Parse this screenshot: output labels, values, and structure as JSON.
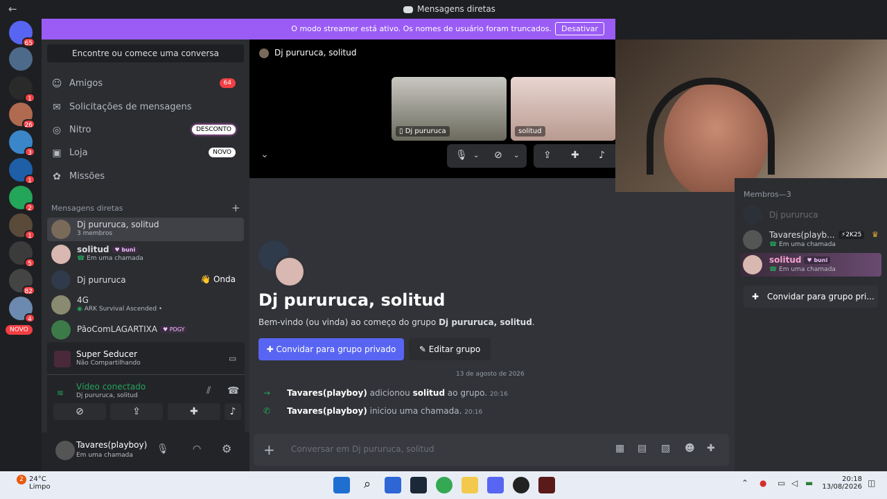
{
  "window": {
    "title": "Mensagens diretas",
    "back_glyph": "←"
  },
  "streamer_banner": {
    "message": "O modo streamer está ativo. Os nomes de usuário foram truncados.",
    "button": "Desativar"
  },
  "rail": {
    "badges": [
      "65",
      "1",
      "26",
      "3",
      "1",
      "2",
      "1",
      "5",
      "82",
      "4"
    ],
    "novo_label": "NOVO"
  },
  "sidebar": {
    "search_label": "Encontre ou comece uma conversa",
    "nav": [
      {
        "label": "Amigos",
        "icon": "friends-icon",
        "pill": "64"
      },
      {
        "label": "Solicitações de mensagens",
        "icon": "mail-icon",
        "pill": ""
      },
      {
        "label": "Nitro",
        "icon": "nitro-icon",
        "pill": "DESCONTO"
      },
      {
        "label": "Loja",
        "icon": "shop-icon",
        "pill": "NOVO"
      },
      {
        "label": "Missões",
        "icon": "quests-icon",
        "pill": ""
      }
    ],
    "dm_header": "Mensagens diretas",
    "dms": [
      {
        "name": "Dj pururuca, solitud",
        "sub": "3 membros"
      },
      {
        "name": "solitud",
        "tag": "buni",
        "sub": "Em uma chamada"
      },
      {
        "name": "Dj pururuca",
        "action": "👋 Onda"
      },
      {
        "name": "4G",
        "sub": "ARK Survival Ascended •"
      },
      {
        "name": "PãoComLAGARTIXA",
        "tag": "PDGY"
      }
    ]
  },
  "voice_panel": {
    "activity_title": "Super Seducer",
    "activity_sub": "Não Compartilhando",
    "status": "Vídeo conectado",
    "channel": "Dj pururuca, solitud"
  },
  "user": {
    "name": "Tavares(playboy)",
    "status": "Em uma chamada"
  },
  "call": {
    "header": "Dj pururuca, solitud",
    "tiles": [
      {
        "label": "Dj pururuca"
      },
      {
        "label": "solitud"
      }
    ]
  },
  "members": {
    "header": "Membros—3",
    "list": [
      {
        "name": "Dj pururuca",
        "sub": ""
      },
      {
        "name": "Tavares(playb...",
        "badge": "2K25",
        "sub": "Em uma chamada"
      },
      {
        "name": "solitud",
        "tag": "buni",
        "sub": "Em uma chamada"
      }
    ],
    "invite": "Convidar para grupo pri..."
  },
  "chat": {
    "title": "Dj pururuca, solitud",
    "welcome_prefix": "Bem-vindo (ou vinda) ao começo do grupo ",
    "welcome_group": "Dj pururuca, solitud",
    "welcome_suffix": ".",
    "invite_button": "Convidar para grupo privado",
    "edit_button": "Editar grupo",
    "date": "13 de agosto de 2026",
    "messages": [
      {
        "actor": "Tavares(playboy)",
        "mid": " adicionou ",
        "target": "solitud",
        "end": " ao grupo.",
        "time": "20:16"
      },
      {
        "actor": "Tavares(playboy)",
        "mid": " iniciou uma chamada.",
        "target": "",
        "end": "",
        "time": "20:16"
      }
    ],
    "composer_placeholder": "Conversar em Dj pururuca, solitud"
  },
  "taskbar": {
    "temp": "24°C",
    "weather": "Limpo",
    "weather_badge": "2",
    "time": "20:18",
    "date": "13/08/2026"
  },
  "colors": {
    "blurple": "#5865f2",
    "streamer": "#9b5cf5",
    "danger": "#da373c",
    "online": "#23a55a"
  }
}
